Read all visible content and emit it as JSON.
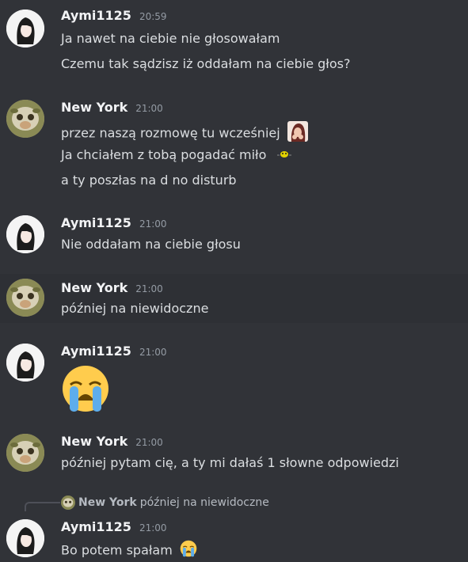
{
  "messages": [
    {
      "author": "Aymi1125",
      "time": "20:59",
      "lines": [
        "Ja nawet na ciebie nie głosowałam",
        "Czemu tak sądzisz iż oddałam na ciebie głos?"
      ]
    },
    {
      "author": "New York",
      "time": "21:00",
      "lines": [
        "przez naszą rozmowę tu wcześniej",
        "Ja chciałem z tobą pogadać miło",
        "a ty poszłas na d no disturb"
      ]
    },
    {
      "author": "Aymi1125",
      "time": "21:00",
      "lines": [
        "Nie oddałam na ciebie głosu"
      ]
    },
    {
      "author": "New York",
      "time": "21:00",
      "lines": [
        "później na niewidoczne"
      ]
    },
    {
      "author": "Aymi1125",
      "time": "21:00",
      "emoji": "sob-emoji"
    },
    {
      "author": "New York",
      "time": "21:00",
      "lines": [
        "później pytam cię, a ty mi dałaś 1 słowne odpowiedzi"
      ]
    },
    {
      "author": "Aymi1125",
      "time": "21:00",
      "lines": [
        "Bo potem spałam"
      ],
      "reply": {
        "author": "New York",
        "text": "później na niewidoczne"
      }
    }
  ],
  "colors": {
    "background": "#313338",
    "highlight": "#2e3035",
    "username": "#f2f3f5",
    "text": "#dbdee1",
    "timestamp": "#949ba4"
  }
}
